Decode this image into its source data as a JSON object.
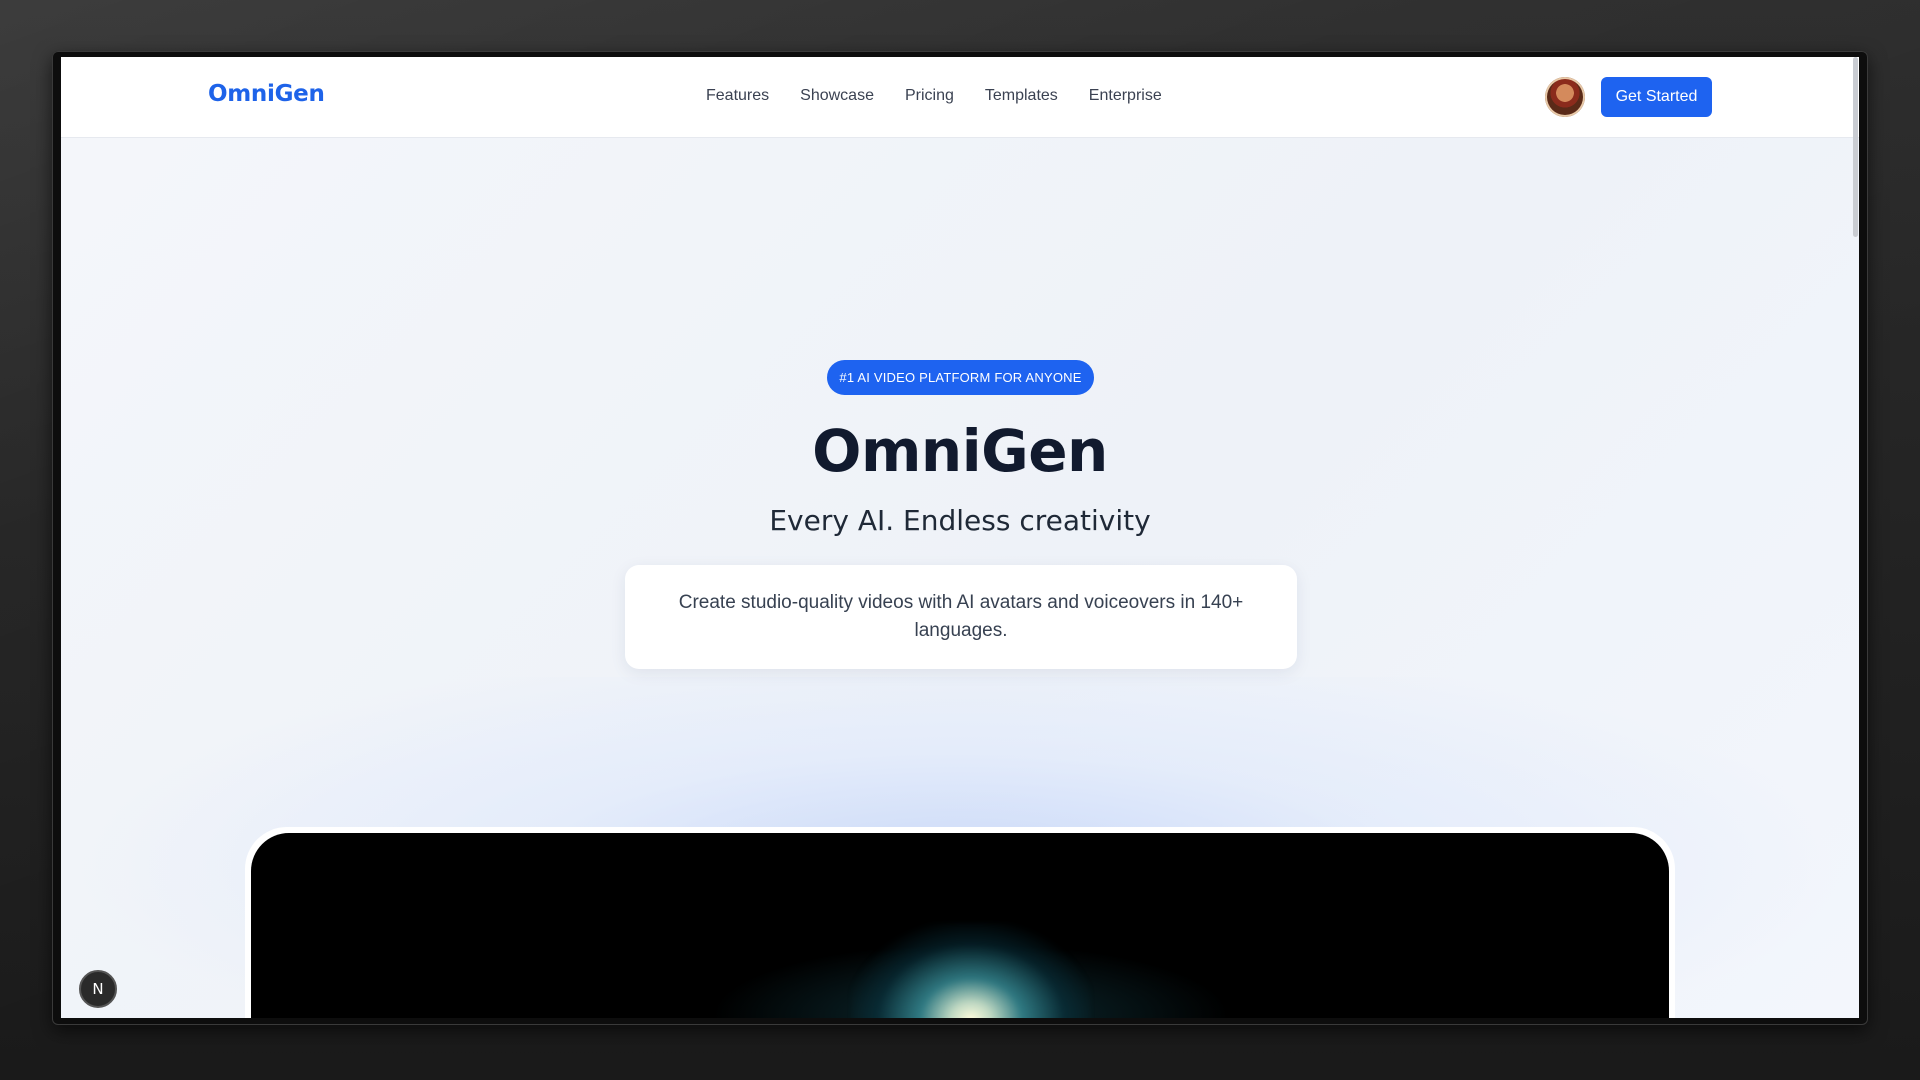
{
  "header": {
    "logo": "OmniGen",
    "nav": [
      "Features",
      "Showcase",
      "Pricing",
      "Templates",
      "Enterprise"
    ],
    "cta_label": "Get Started"
  },
  "hero": {
    "badge": "#1 AI VIDEO PLATFORM FOR ANYONE",
    "title": "OmniGen",
    "subtitle": "Every AI. Endless creativity",
    "description": "Create studio-quality videos with AI avatars and voiceovers in 140+ languages."
  },
  "dev_indicator": {
    "label": "N"
  },
  "colors": {
    "brand": "#1e63f0",
    "title": "#111a2e",
    "background": "#f3f6fb"
  }
}
